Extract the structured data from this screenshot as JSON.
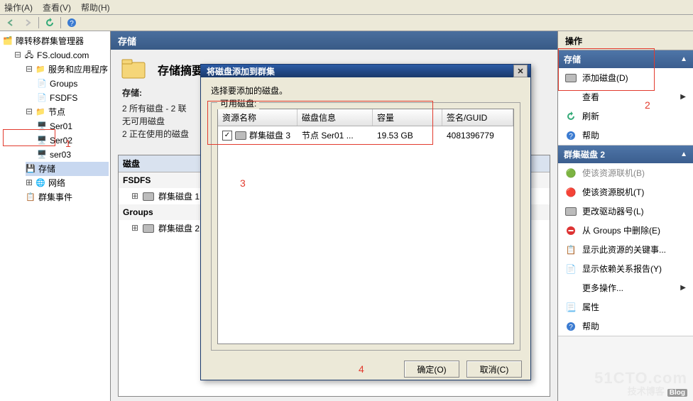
{
  "menubar": {
    "items": [
      "操作(A)",
      "查看(V)",
      "帮助(H)"
    ]
  },
  "tree": {
    "root_label": "障转移群集管理器",
    "domain": "FS.cloud.com",
    "services_label": "服务和应用程序",
    "services": [
      "Groups",
      "FSDFS"
    ],
    "nodes_label": "节点",
    "nodes": [
      "Ser01",
      "Ser02",
      "ser03"
    ],
    "storage_label": "存储",
    "network_label": "网络",
    "events_label": "群集事件"
  },
  "content": {
    "header": "存储",
    "summary_title": "存储摘要",
    "storage_hdr": "存储:",
    "line1": "2 所有磁盘 - 2 联",
    "line2": "无可用磁盘",
    "line3": "2 正在使用的磁盘",
    "disks_panel_title": "磁盘",
    "group1": "FSDFS",
    "group1_item": "群集磁盘 1",
    "group2": "Groups",
    "group2_item": "群集磁盘 2"
  },
  "actions": {
    "pane_title": "操作",
    "section1_title": "存储",
    "section1_items": [
      {
        "label": "添加磁盘(D)",
        "icon": "disk"
      },
      {
        "label": "查看",
        "icon": "none",
        "arrow": true
      },
      {
        "label": "刷新",
        "icon": "refresh"
      },
      {
        "label": "帮助",
        "icon": "help"
      }
    ],
    "section2_title": "群集磁盘 2",
    "section2_items": [
      {
        "label": "使该资源联机(B)",
        "icon": "online",
        "dim": true
      },
      {
        "label": "使该资源脱机(T)",
        "icon": "offline"
      },
      {
        "label": "更改驱动器号(L)",
        "icon": "disk"
      },
      {
        "label": "从 Groups 中删除(E)",
        "icon": "delete"
      },
      {
        "label": "显示此资源的关键事...",
        "icon": "events"
      },
      {
        "label": "显示依赖关系报告(Y)",
        "icon": "report"
      },
      {
        "label": "更多操作...",
        "icon": "none",
        "arrow": true
      },
      {
        "label": "属性",
        "icon": "props"
      },
      {
        "label": "帮助",
        "icon": "help"
      }
    ]
  },
  "dialog": {
    "title": "将磁盘添加到群集",
    "instruction": "选择要添加的磁盘。",
    "group_legend": "可用磁盘:",
    "cols": {
      "res": "资源名称",
      "info": "磁盘信息",
      "cap": "容量",
      "sig": "签名/GUID"
    },
    "row": {
      "checked": true,
      "res": "群集磁盘 3",
      "info": "节点 Ser01 ...",
      "cap": "19.53 GB",
      "sig": "4081396779"
    },
    "ok": "确定(O)",
    "cancel": "取消(C)"
  },
  "annotations": {
    "n1": "1",
    "n2": "2",
    "n3": "3",
    "n4": "4"
  },
  "watermark": {
    "l1": "51CTO.com",
    "l2": "技术博客",
    "tag": "Blog"
  }
}
